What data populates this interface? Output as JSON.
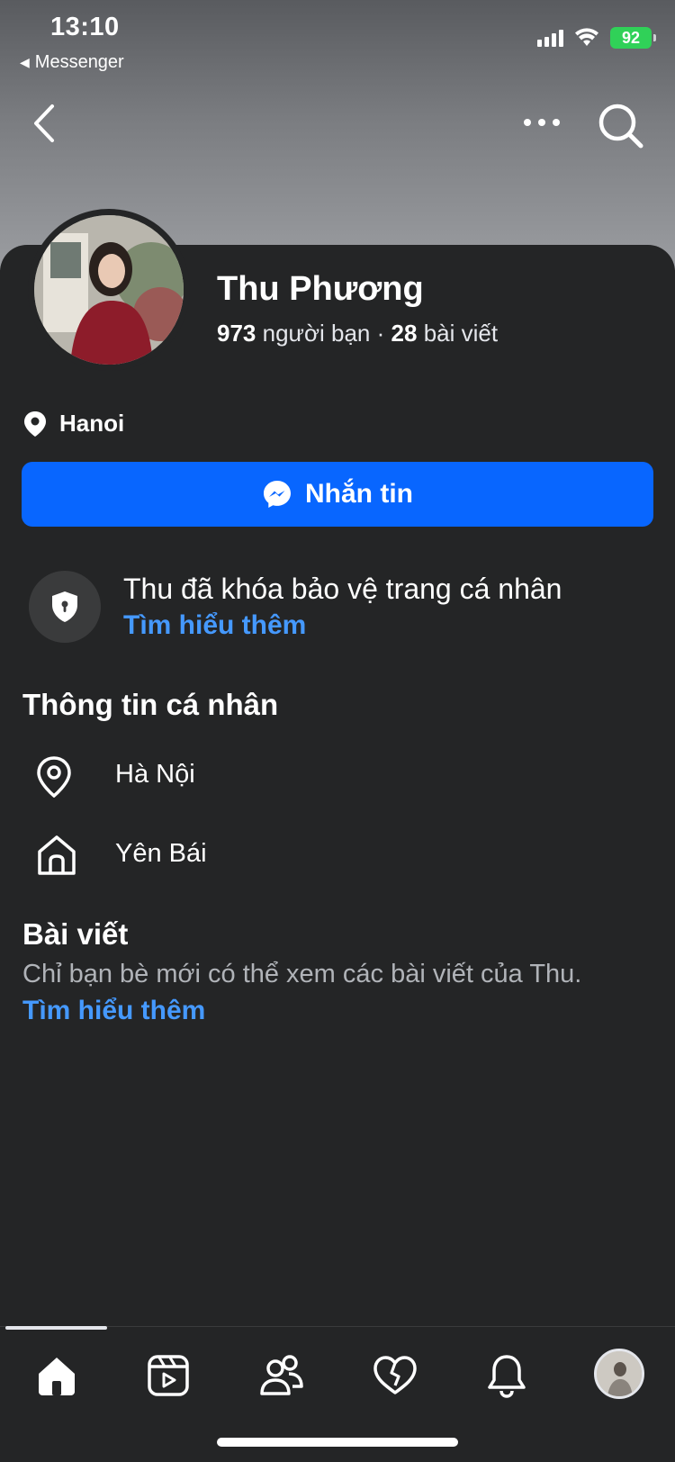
{
  "status_bar": {
    "time": "13:10",
    "back_app": "Messenger",
    "battery": "92"
  },
  "profile": {
    "name": "Thu Phương",
    "friends_count": "973",
    "friends_label": "người bạn",
    "separator": "·",
    "posts_count": "28",
    "posts_label": "bài viết",
    "location": "Hanoi"
  },
  "actions": {
    "message_label": "Nhắn tin"
  },
  "lock_notice": {
    "title": "Thu đã khóa bảo vệ trang cá nhân",
    "link": "Tìm hiểu thêm"
  },
  "personal_info": {
    "title": "Thông tin cá nhân",
    "items": [
      {
        "icon": "location-pin-icon",
        "label": "Hà Nội"
      },
      {
        "icon": "home-icon",
        "label": "Yên Bái"
      }
    ]
  },
  "posts": {
    "title": "Bài viết",
    "description": "Chỉ bạn bè mới có thể xem các bài viết của Thu.",
    "link": "Tìm hiểu thêm"
  },
  "tabs": [
    "home-icon",
    "video-icon",
    "friends-icon",
    "dating-heart-icon",
    "bell-icon",
    "profile-avatar"
  ],
  "colors": {
    "accent": "#0866ff",
    "link": "#4599ff",
    "background": "#242526",
    "battery": "#30d158"
  }
}
